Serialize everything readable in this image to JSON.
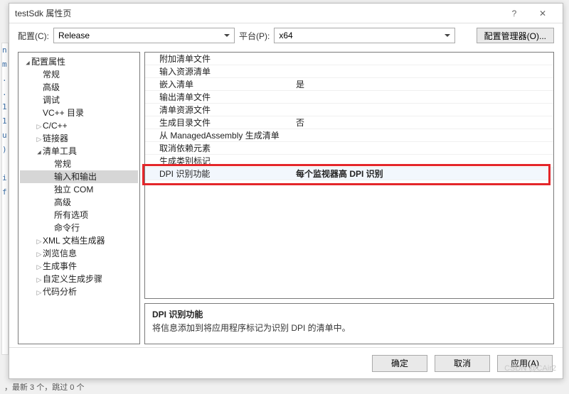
{
  "window": {
    "title": "testSdk 属性页"
  },
  "toolbar": {
    "config_label": "配置(C):",
    "config_value": "Release",
    "platform_label": "平台(P):",
    "platform_value": "x64",
    "config_mgr": "配置管理器(O)..."
  },
  "tree": [
    {
      "label": "配置属性",
      "indent": 0,
      "arrow": "▸",
      "open": true
    },
    {
      "label": "常规",
      "indent": 1,
      "arrow": ""
    },
    {
      "label": "高级",
      "indent": 1,
      "arrow": ""
    },
    {
      "label": "调试",
      "indent": 1,
      "arrow": ""
    },
    {
      "label": "VC++ 目录",
      "indent": 1,
      "arrow": ""
    },
    {
      "label": "C/C++",
      "indent": 1,
      "arrow": "▹"
    },
    {
      "label": "链接器",
      "indent": 1,
      "arrow": "▹"
    },
    {
      "label": "清单工具",
      "indent": 1,
      "arrow": "▸",
      "open": true
    },
    {
      "label": "常规",
      "indent": 2,
      "arrow": ""
    },
    {
      "label": "输入和输出",
      "indent": 2,
      "arrow": "",
      "selected": true
    },
    {
      "label": "独立 COM",
      "indent": 2,
      "arrow": ""
    },
    {
      "label": "高级",
      "indent": 2,
      "arrow": ""
    },
    {
      "label": "所有选项",
      "indent": 2,
      "arrow": ""
    },
    {
      "label": "命令行",
      "indent": 2,
      "arrow": ""
    },
    {
      "label": "XML 文档生成器",
      "indent": 1,
      "arrow": "▹"
    },
    {
      "label": "浏览信息",
      "indent": 1,
      "arrow": "▹"
    },
    {
      "label": "生成事件",
      "indent": 1,
      "arrow": "▹"
    },
    {
      "label": "自定义生成步骤",
      "indent": 1,
      "arrow": "▹"
    },
    {
      "label": "代码分析",
      "indent": 1,
      "arrow": "▹"
    }
  ],
  "props": [
    {
      "name": "附加清单文件",
      "value": ""
    },
    {
      "name": "输入资源清单",
      "value": ""
    },
    {
      "name": "嵌入清单",
      "value": "是"
    },
    {
      "name": "输出清单文件",
      "value": ""
    },
    {
      "name": "清单资源文件",
      "value": ""
    },
    {
      "name": "生成目录文件",
      "value": "否"
    },
    {
      "name": "从 ManagedAssembly 生成清单",
      "value": ""
    },
    {
      "name": "取消依赖元素",
      "value": ""
    },
    {
      "name": "生成类别标记",
      "value": ""
    },
    {
      "name": "DPI 识别功能",
      "value": "每个监视器高 DPI 识别",
      "selected": true
    }
  ],
  "desc": {
    "title": "DPI 识别功能",
    "text": "将信息添加到将应用程序标记为识别 DPI 的清单中。"
  },
  "footer": {
    "ok": "确定",
    "cancel": "取消",
    "apply": "应用(A)"
  },
  "watermark": "CSDN @CAir2",
  "statusbar": "，最新 3 个，跳过 0 个"
}
